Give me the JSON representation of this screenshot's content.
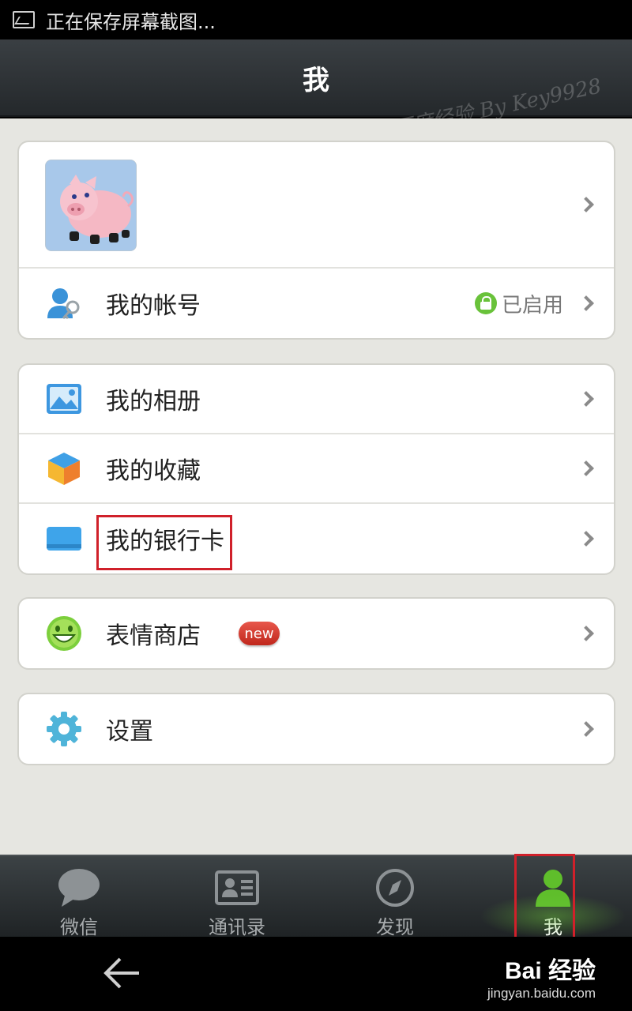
{
  "status_bar": {
    "text": "正在保存屏幕截图...",
    "icon": "image-icon"
  },
  "header": {
    "title": "我",
    "watermark": "百度经验 By Key9928"
  },
  "profile": {
    "avatar": "pig-avatar"
  },
  "account": {
    "label": "我的帐号",
    "status": "已启用",
    "icon": "account-key-icon"
  },
  "menu_group_2": [
    {
      "label": "我的相册",
      "icon": "album-icon"
    },
    {
      "label": "我的收藏",
      "icon": "favorites-box-icon"
    },
    {
      "label": "我的银行卡",
      "icon": "bank-card-icon"
    }
  ],
  "sticker_store": {
    "label": "表情商店",
    "badge": "new",
    "icon": "smiley-icon"
  },
  "settings": {
    "label": "设置",
    "icon": "gear-icon"
  },
  "tabs": [
    {
      "label": "微信",
      "icon": "chat-bubble-icon",
      "active": false
    },
    {
      "label": "通讯录",
      "icon": "contacts-card-icon",
      "active": false
    },
    {
      "label": "发现",
      "icon": "compass-icon",
      "active": false
    },
    {
      "label": "我",
      "icon": "person-icon",
      "active": true
    }
  ],
  "baidu_logo": {
    "brand": "Bai 经验",
    "url": "jingyan.baidu.com"
  },
  "colors": {
    "accent_green": "#69c23a",
    "highlight_red": "#d0202a",
    "title_bar": "#2e3336"
  }
}
